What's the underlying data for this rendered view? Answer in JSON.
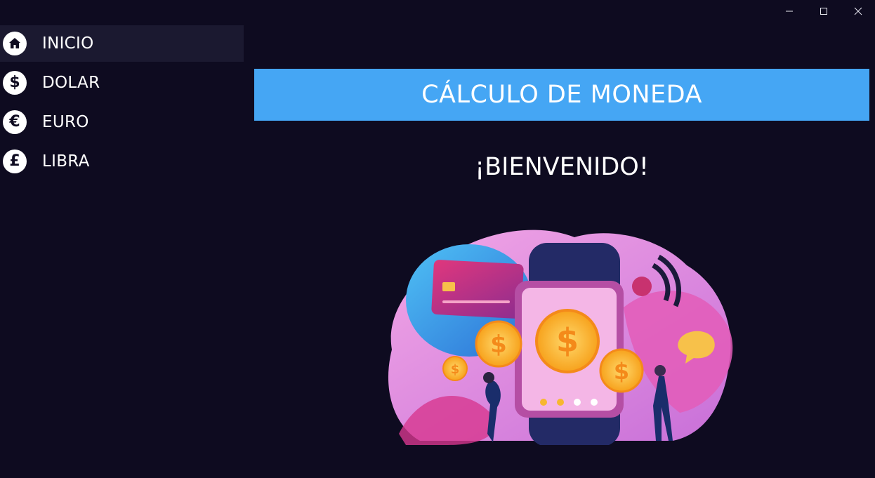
{
  "window": {
    "controls": [
      "minimize",
      "maximize",
      "close"
    ]
  },
  "sidebar": {
    "items": [
      {
        "label": "INICIO",
        "icon": "home-icon",
        "active": true
      },
      {
        "label": "DOLAR",
        "icon": "dollar-icon",
        "active": false
      },
      {
        "label": "EURO",
        "icon": "euro-icon",
        "active": false
      },
      {
        "label": "LIBRA",
        "icon": "pound-icon",
        "active": false
      }
    ]
  },
  "main": {
    "header": "CÁLCULO DE MONEDA",
    "welcome": "¡BIENVENIDO!",
    "illustration": "money-illustration"
  },
  "colors": {
    "background": "#0e0b20",
    "sidebar_active": "#1b1930",
    "header_bg": "#45a6f4",
    "text": "#ffffff"
  }
}
